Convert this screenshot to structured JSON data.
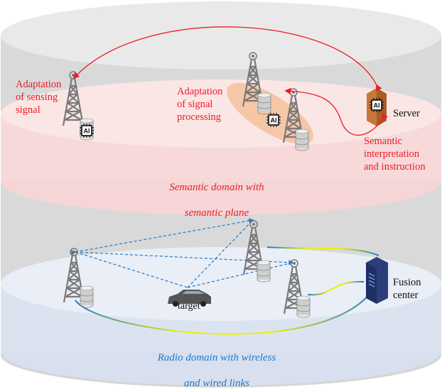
{
  "semantic_layer": {
    "title_line1": "Semantic domain with",
    "title_line2": "semantic plane",
    "label_sensing": "Adaptation\nof sensing\nsignal",
    "label_processing": "Adaptation\nof signal\nprocessing",
    "label_interpretation": "Semantic\ninterpretation\nand instruction",
    "server_label": "Server",
    "chip_text": "AI"
  },
  "radio_layer": {
    "title_line1": "Radio domain with wireless",
    "title_line2": "and wired links",
    "target_label": "target",
    "fusion_label": "Fusion\ncenter"
  },
  "colors": {
    "semantic_text": "#ee1c24",
    "radio_text": "#1f78c8",
    "semantic_layer": "#f7d9da",
    "radio_layer": "#dbe3f1",
    "outer_cylinder": "#d9d9d9",
    "wireless_link": "#1f78c8",
    "semantic_arrow": "#ee1c24"
  }
}
